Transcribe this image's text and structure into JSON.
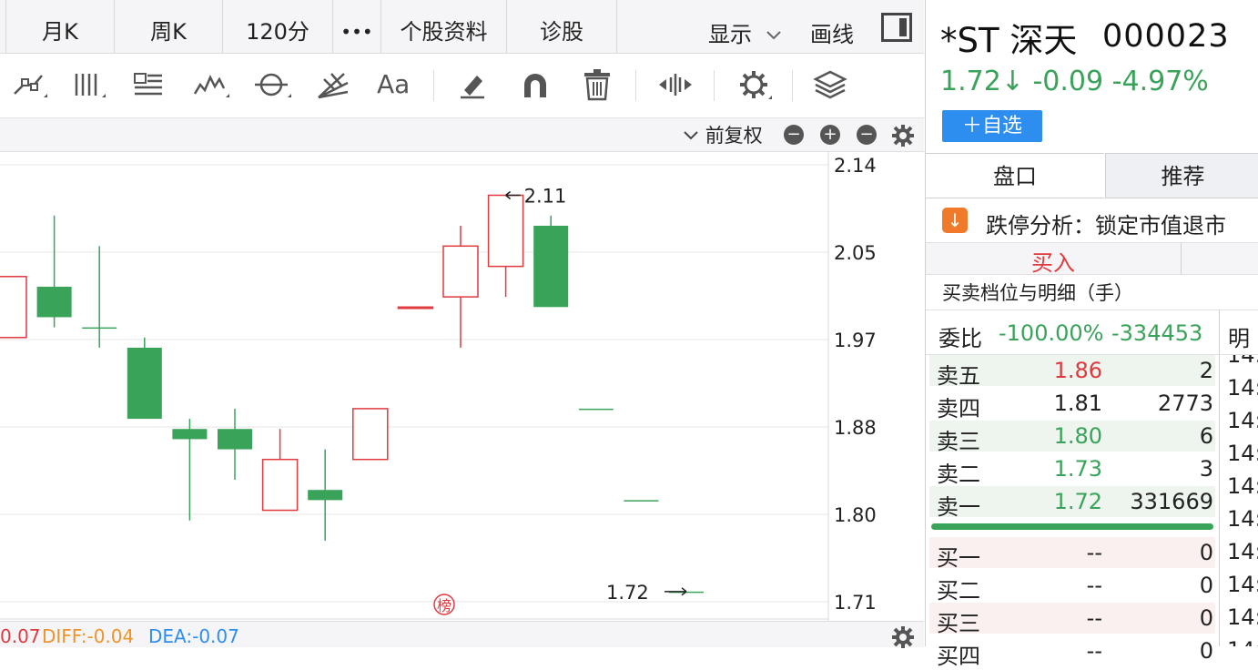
{
  "period_tabs": [
    "月K",
    "周K",
    "120分",
    "•••",
    "个股资料",
    "诊股"
  ],
  "top_menu": {
    "show": "显示",
    "draw": "画线"
  },
  "chart_header": {
    "adjust": "前复权",
    "zoom_out": "−",
    "zoom_in": "+",
    "minus": "−"
  },
  "chart_data": {
    "type": "candlestick",
    "y_ticks": [
      "2.14",
      "2.05",
      "1.97",
      "1.88",
      "1.80",
      "1.71"
    ],
    "ylim": [
      1.71,
      2.14
    ],
    "max_label": "2.11",
    "min_label": "1.72",
    "badge": "榜",
    "candles": [
      {
        "open": 1.97,
        "close": 2.03,
        "high": 2.03,
        "low": 1.97,
        "color": "red"
      },
      {
        "open": 2.02,
        "close": 1.99,
        "high": 2.09,
        "low": 1.98,
        "color": "green"
      },
      {
        "open": 1.98,
        "close": 1.98,
        "high": 2.06,
        "low": 1.96,
        "color": "green"
      },
      {
        "open": 1.96,
        "close": 1.89,
        "high": 1.97,
        "low": 1.89,
        "color": "green"
      },
      {
        "open": 1.88,
        "close": 1.87,
        "high": 1.89,
        "low": 1.79,
        "color": "green"
      },
      {
        "open": 1.88,
        "close": 1.86,
        "high": 1.9,
        "low": 1.83,
        "color": "green"
      },
      {
        "open": 1.8,
        "close": 1.85,
        "high": 1.88,
        "low": 1.8,
        "color": "red"
      },
      {
        "open": 1.82,
        "close": 1.81,
        "high": 1.86,
        "low": 1.77,
        "color": "green"
      },
      {
        "open": 1.85,
        "close": 1.9,
        "high": 1.9,
        "low": 1.85,
        "color": "red"
      },
      {
        "open": 2.0,
        "close": 2.0,
        "high": 2.0,
        "low": 2.0,
        "color": "red"
      },
      {
        "open": 2.01,
        "close": 2.06,
        "high": 2.08,
        "low": 1.96,
        "color": "red"
      },
      {
        "open": 2.04,
        "close": 2.11,
        "high": 2.11,
        "low": 2.01,
        "color": "red"
      },
      {
        "open": 2.08,
        "close": 2.0,
        "high": 2.09,
        "low": 2.0,
        "color": "green"
      },
      {
        "open": 1.9,
        "close": 1.9,
        "high": 1.9,
        "low": 1.9,
        "color": "green"
      },
      {
        "open": 1.81,
        "close": 1.81,
        "high": 1.81,
        "low": 1.81,
        "color": "green"
      },
      {
        "open": 1.72,
        "close": 1.72,
        "high": 1.72,
        "low": 1.72,
        "color": "green"
      }
    ]
  },
  "indicators": {
    "macd": "0.07",
    "diff": "DIFF:-0.04",
    "dea": "DEA:-0.07"
  },
  "stock": {
    "name": "*ST 深天",
    "code": "000023",
    "price": "1.72↓",
    "change": "-0.09",
    "pct": "-4.97%",
    "fav": "＋自选"
  },
  "right_tabs": {
    "pankou": "盘口",
    "tuijian": "推荐"
  },
  "limit": {
    "icon": "↓",
    "text": "跌停分析：锁定市值退市"
  },
  "buy_label": "买入",
  "detail_title": "买卖档位与明细（手）",
  "webi": {
    "label": "委比",
    "pct": "-100.00%",
    "vol": "-334453",
    "ming": "明"
  },
  "orderbook": {
    "sells": [
      {
        "label": "卖五",
        "price": "1.86",
        "vol": "2",
        "pc": "red"
      },
      {
        "label": "卖四",
        "price": "1.81",
        "vol": "2773",
        "pc": "dark"
      },
      {
        "label": "卖三",
        "price": "1.80",
        "vol": "6",
        "pc": "green"
      },
      {
        "label": "卖二",
        "price": "1.73",
        "vol": "3",
        "pc": "green"
      },
      {
        "label": "卖一",
        "price": "1.72",
        "vol": "331669",
        "pc": "green"
      }
    ],
    "buys": [
      {
        "label": "买一",
        "price": "--",
        "vol": "0",
        "pc": "dark"
      },
      {
        "label": "买二",
        "price": "--",
        "vol": "0",
        "pc": "dark"
      },
      {
        "label": "买三",
        "price": "--",
        "vol": "0",
        "pc": "dark"
      },
      {
        "label": "买四",
        "price": "--",
        "vol": "0",
        "pc": "dark"
      }
    ]
  },
  "times": [
    "14:",
    "14:",
    "14:",
    "14:",
    "14:",
    "14:",
    "14:",
    "14:",
    "14:",
    "14:"
  ]
}
